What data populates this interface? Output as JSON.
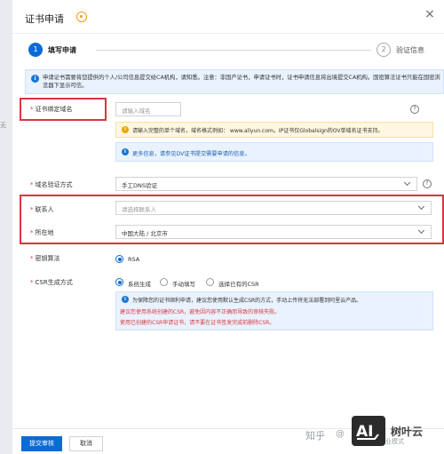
{
  "dialog": {
    "title": "证书申请",
    "close_glyph": "×"
  },
  "steps": [
    {
      "num": "1",
      "label": "填写申请"
    },
    {
      "num": "2",
      "label": "验证信息"
    }
  ],
  "notice": {
    "text": "申请证书需要将您提供的个人/公司信息提交给CA机构，请知悉。注意：非国产证书，申请证书时，证书申请信息将出境提交CA机构。国密算法证书只能在国密浏览器下显示可信。"
  },
  "sidebar_cut": "无",
  "form": {
    "domain": {
      "label": "证书绑定域名",
      "placeholder": "请输入域名",
      "tip_yellow": "请输入完整的单个域名，域名格式例如： www.aliyun.com。IP证书仅Globalsign的OV单域名证书支持。",
      "tip_blue": "更多信息，请参见DV证书提交需要申请的信息。"
    },
    "verify": {
      "label": "域名验证方式",
      "value": "手工DNS验证"
    },
    "contact": {
      "label": "联系人",
      "placeholder": "请选择联系人"
    },
    "location": {
      "label": "所在地",
      "value": "中国大陆 / 北京市"
    },
    "algo": {
      "label": "密钥算法",
      "option": "RSA"
    },
    "csr": {
      "label": "CSR生成方式",
      "options": [
        "系统生成",
        "手动填写",
        "选择已有的CSR"
      ],
      "tip_line1": "为保障您的证书顺利申请，建议您使用默认生成CSR的方式，手动上传将无法部署到阿里云产品。",
      "tip_line2": "建议您使用系统创建的CSR，避免因内容不正确而导致的审核失败。",
      "tip_line3": "使用已创建的CSR申请证书，请不要在证书签发完成前删除CSR。"
    }
  },
  "footer": {
    "submit": "提交审核",
    "cancel": "取消"
  },
  "watermark": {
    "zhihu": "知乎",
    "at": "@",
    "brand": "树叶云",
    "sub": "业模式"
  },
  "colors": {
    "primary": "#0b6bd6",
    "highlight_border": "#d9363e"
  },
  "icons": {
    "help": "help-circle-icon",
    "info": "info-icon",
    "warning": "warning-icon",
    "close": "close-icon",
    "chevron": "chevron-down-icon",
    "question": "question-mark-icon"
  }
}
